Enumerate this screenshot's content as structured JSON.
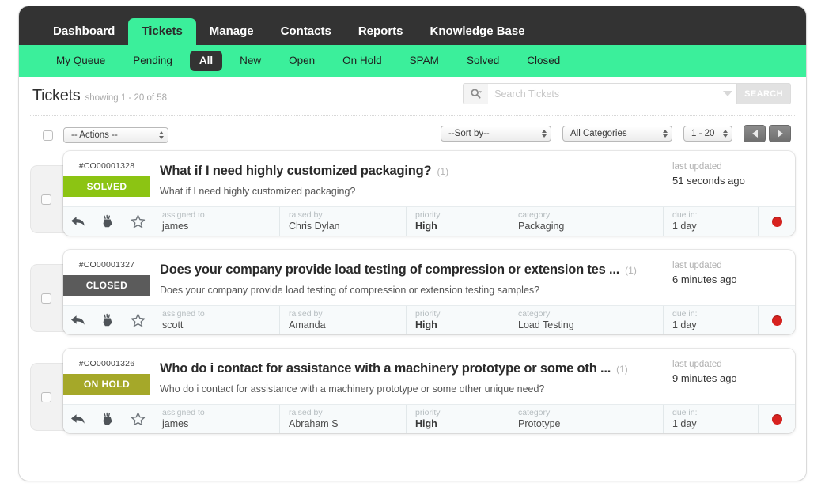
{
  "topnav": {
    "items": [
      {
        "label": "Dashboard",
        "active": false
      },
      {
        "label": "Tickets",
        "active": true
      },
      {
        "label": "Manage",
        "active": false
      },
      {
        "label": "Contacts",
        "active": false
      },
      {
        "label": "Reports",
        "active": false
      },
      {
        "label": "Knowledge Base",
        "active": false
      }
    ]
  },
  "subnav": {
    "items": [
      {
        "label": "My Queue",
        "active": false
      },
      {
        "label": "Pending",
        "active": false
      },
      {
        "label": "All",
        "active": true
      },
      {
        "label": "New",
        "active": false
      },
      {
        "label": "Open",
        "active": false
      },
      {
        "label": "On Hold",
        "active": false
      },
      {
        "label": "SPAM",
        "active": false
      },
      {
        "label": "Solved",
        "active": false
      },
      {
        "label": "Closed",
        "active": false
      }
    ]
  },
  "header": {
    "title": "Tickets",
    "showing": "showing 1 - 20 of 58"
  },
  "search": {
    "placeholder": "Search Tickets",
    "value": "",
    "button_label": "SEARCH",
    "scope_icon": "search-icon",
    "dropdown_icon": "chevron-down-icon"
  },
  "toolbar": {
    "actions_select": "-- Actions --",
    "sort_select": "--Sort by--",
    "category_select": "All Categories",
    "page_select": "1 - 20",
    "prev_label": "prev-page",
    "next_label": "next-page"
  },
  "footer_labels": {
    "assigned_to": "assigned to",
    "raised_by": "raised by",
    "priority": "priority",
    "category": "category",
    "due_in": "due in:",
    "last_updated": "last updated"
  },
  "colors": {
    "brand_green": "#3BEF9B",
    "nav_dark": "#333333",
    "solved": "#8CC413",
    "closed": "#5B5B5B",
    "onhold": "#A5A829",
    "flag_red": "#d8221f"
  },
  "tickets": [
    {
      "id": "#CO00001328",
      "status": "SOLVED",
      "status_class": "badge-solved",
      "title": "What if I need highly customized packaging?",
      "count": "(1)",
      "description": "What if I need highly customized packaging?",
      "last_updated": "51 seconds ago",
      "assigned_to": "james",
      "raised_by": "Chris Dylan",
      "priority": "High",
      "category": "Packaging",
      "due_in": "1 day"
    },
    {
      "id": "#CO00001327",
      "status": "CLOSED",
      "status_class": "badge-closed",
      "title": "Does your company provide load testing of compression or extension tes ...",
      "count": "(1)",
      "description": "Does your company provide load testing of compression or extension testing samples?",
      "last_updated": "6 minutes ago",
      "assigned_to": "scott",
      "raised_by": "Amanda",
      "priority": "High",
      "category": "Load Testing",
      "due_in": "1 day"
    },
    {
      "id": "#CO00001326",
      "status": "ON HOLD",
      "status_class": "badge-onhold",
      "title": "Who do i contact for assistance with a machinery prototype or some oth ...",
      "count": "(1)",
      "description": "Who do i contact for assistance with a machinery prototype or some other unique need?",
      "last_updated": "9 minutes ago",
      "assigned_to": "james",
      "raised_by": "Abraham S",
      "priority": "High",
      "category": "Prototype",
      "due_in": "1 day"
    }
  ]
}
